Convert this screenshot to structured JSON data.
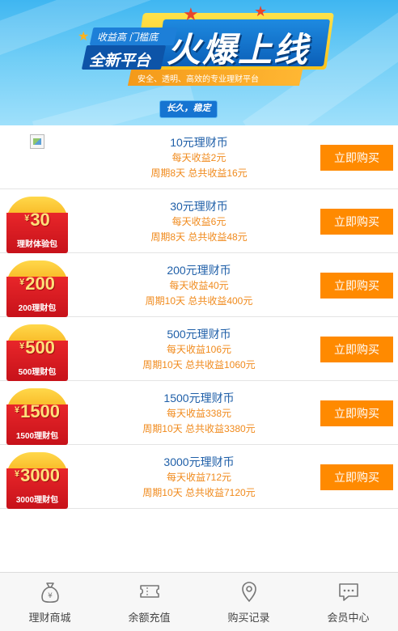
{
  "banner": {
    "tagline": "收益高 门槛底",
    "platform": "全新平台",
    "headline": "火爆上线",
    "ribbon": "安全、透明、高效的专业理财平台",
    "slogan": "长久，稳定"
  },
  "products": [
    {
      "badge_amount": "",
      "badge_name": "",
      "title": "10元理财币",
      "daily": "每天收益2元",
      "cycle": "周期8天 总共收益16元",
      "button": "立即购买"
    },
    {
      "badge_amount": "30",
      "badge_name": "理财体验包",
      "title": "30元理财币",
      "daily": "每天收益6元",
      "cycle": "周期8天 总共收益48元",
      "button": "立即购买"
    },
    {
      "badge_amount": "200",
      "badge_name": "200理财包",
      "title": "200元理财币",
      "daily": "每天收益40元",
      "cycle": "周期10天 总共收益400元",
      "button": "立即购买"
    },
    {
      "badge_amount": "500",
      "badge_name": "500理财包",
      "title": "500元理财币",
      "daily": "每天收益106元",
      "cycle": "周期10天 总共收益1060元",
      "button": "立即购买"
    },
    {
      "badge_amount": "1500",
      "badge_name": "1500理财包",
      "title": "1500元理财币",
      "daily": "每天收益338元",
      "cycle": "周期10天 总共收益3380元",
      "button": "立即购买"
    },
    {
      "badge_amount": "3000",
      "badge_name": "3000理财包",
      "title": "3000元理财币",
      "daily": "每天收益712元",
      "cycle": "周期10天 总共收益7120元",
      "button": "立即购买"
    }
  ],
  "badge_currency": "¥",
  "tabbar": {
    "tabs": [
      {
        "label": "理财商城",
        "icon": "money-bag-icon"
      },
      {
        "label": "余额充值",
        "icon": "ticket-icon"
      },
      {
        "label": "购买记录",
        "icon": "location-pin-icon"
      },
      {
        "label": "会员中心",
        "icon": "chat-bubble-icon"
      }
    ]
  },
  "colors": {
    "buy_button": "#ff8a00",
    "title_text": "#1f5fa8",
    "earnings_text": "#f08a1c",
    "badge_red": "#d41c20",
    "badge_gold": "#f5a914"
  }
}
